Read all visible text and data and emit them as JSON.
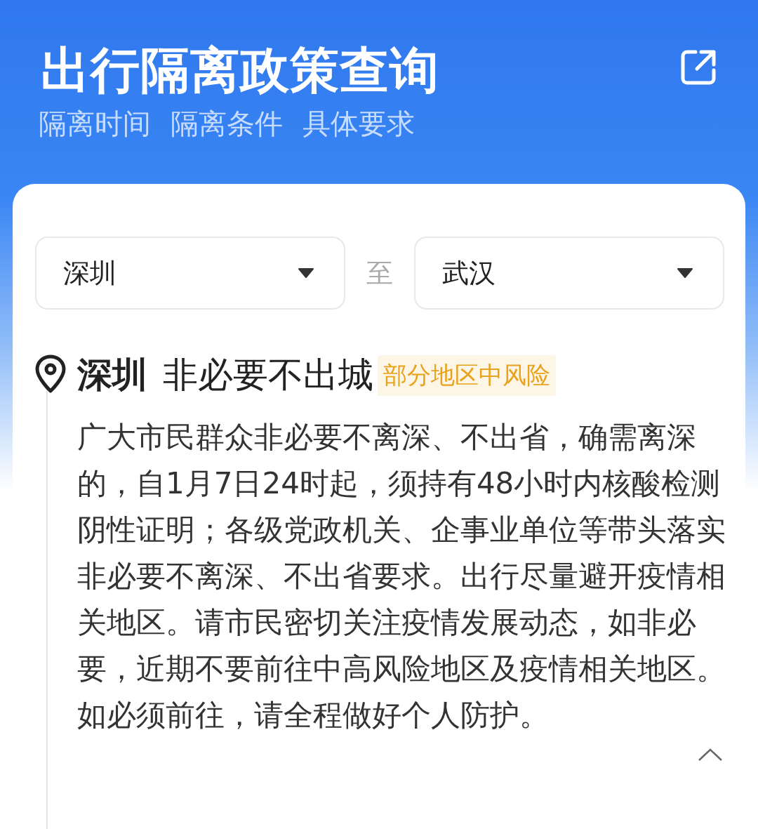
{
  "header": {
    "title": "出行隔离政策查询",
    "subtitles": [
      "隔离时间",
      "隔离条件",
      "具体要求"
    ]
  },
  "route": {
    "from": "深圳",
    "separator": "至",
    "to": "武汉"
  },
  "result": {
    "city": "深圳",
    "policy": "非必要不出城",
    "risk_badge": "部分地区中风险",
    "description": "广大市民群众非必要不离深、不出省，确需离深的，自1月7日24时起，须持有48小时内核酸检测阴性证明；各级党政机关、企事业单位等带头落实非必要不离深、不出省要求。出行尽量避开疫情相关地区。请市民密切关注疫情发展动态，如非必要，近期不要前往中高风险地区及疫情相关地区。如必须前往，请全程做好个人防护。"
  }
}
